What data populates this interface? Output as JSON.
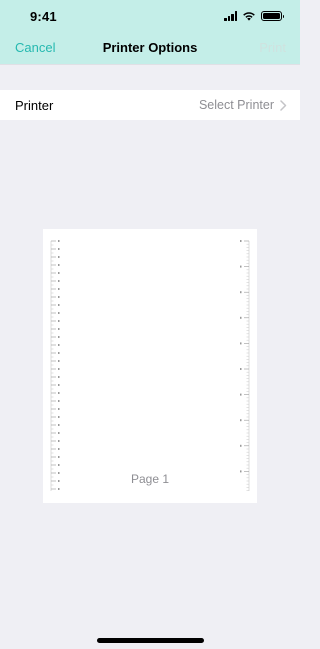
{
  "status_bar": {
    "time": "9:41",
    "icons": [
      "cellular-signal-icon",
      "wifi-icon",
      "battery-icon"
    ],
    "battery_level": 1.0
  },
  "nav": {
    "cancel_label": "Cancel",
    "title": "Printer Options",
    "print_label": "Print",
    "print_enabled": false
  },
  "printer_row": {
    "label": "Printer",
    "value": "Select Printer",
    "icon": "chevron-right-icon"
  },
  "preview": {
    "page_label": "Page 1"
  },
  "colors": {
    "header_bg": "#c4eee8",
    "accent": "#26b9b0",
    "disabled": "#cfe2df",
    "page_bg": "#efeff4",
    "secondary_text": "#8e8e93"
  }
}
